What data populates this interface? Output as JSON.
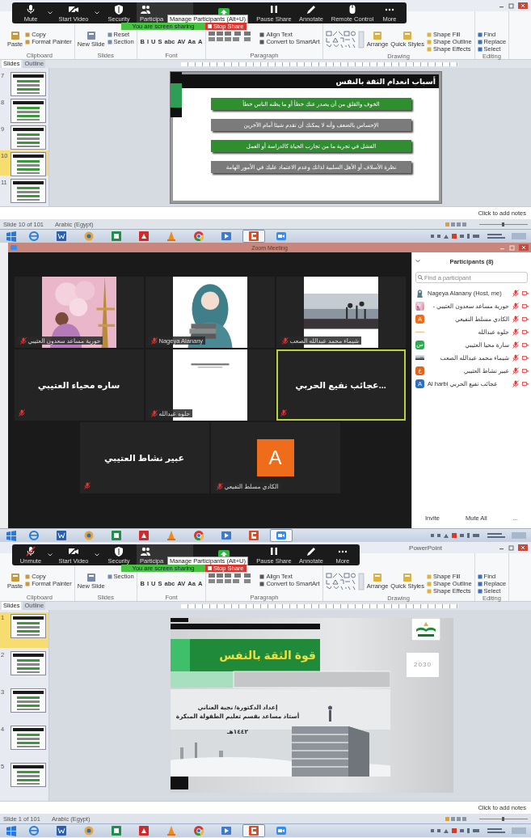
{
  "top_powerpoint": {
    "zoom_toolbar": {
      "buttons": [
        {
          "kind": "mic",
          "label": "Mute",
          "muted": false
        },
        {
          "kind": "video",
          "label": "Start Video"
        },
        {
          "kind": "security",
          "label": "Security"
        },
        {
          "kind": "participants",
          "label": "Participa"
        },
        {
          "kind": "share"
        },
        {
          "kind": "pause",
          "label": "Pause Share"
        },
        {
          "kind": "annotate",
          "label": "Annotate"
        },
        {
          "kind": "remote",
          "label": "Remote Control"
        },
        {
          "kind": "more",
          "label": "More"
        }
      ],
      "tooltip": "Manage Participants (Alt+U)",
      "sharing_text": "You are screen sharing",
      "stop_button": "Stop Share"
    },
    "ribbon": [
      {
        "kind": "clipboard",
        "name": "Clipboard",
        "items": [
          {
            "kind": "large",
            "label": "Paste"
          },
          {
            "kind": "small",
            "label": "Copy"
          },
          {
            "kind": "small",
            "label": "Format Painter"
          }
        ]
      },
      {
        "kind": "slides",
        "name": "Slides",
        "items": [
          {
            "kind": "large",
            "label": "New Slide"
          },
          {
            "kind": "small",
            "label": "Reset"
          },
          {
            "kind": "small",
            "label": "Section"
          }
        ]
      },
      {
        "kind": "font",
        "name": "Font",
        "items": [
          {
            "kind": "glyph",
            "label": "B"
          },
          {
            "kind": "glyph",
            "label": "I"
          },
          {
            "kind": "glyph",
            "label": "U"
          },
          {
            "kind": "glyph",
            "label": "S"
          },
          {
            "kind": "glyph",
            "label": "abc"
          },
          {
            "kind": "glyph",
            "label": "AV"
          },
          {
            "kind": "glyph",
            "label": "Aa"
          },
          {
            "kind": "glyph",
            "label": "A"
          }
        ]
      },
      {
        "kind": "paragraph",
        "name": "Paragraph",
        "items": [
          {
            "kind": "small",
            "label": "Align Text"
          },
          {
            "kind": "small",
            "label": "Convert to SmartArt"
          }
        ]
      },
      {
        "kind": "drawing",
        "name": "Drawing",
        "items": [
          {
            "kind": "large",
            "label": "Arrange"
          },
          {
            "kind": "large",
            "label": "Quick Styles"
          },
          {
            "kind": "small",
            "label": "Shape Fill"
          },
          {
            "kind": "small",
            "label": "Shape Outline"
          },
          {
            "kind": "small",
            "label": "Shape Effects"
          }
        ]
      },
      {
        "kind": "editing",
        "name": "Editing",
        "items": [
          {
            "kind": "small",
            "label": "Find"
          },
          {
            "kind": "small",
            "label": "Replace"
          },
          {
            "kind": "small",
            "label": "Select"
          }
        ]
      }
    ],
    "panel_tabs": [
      {
        "label": "Slides",
        "selected": true
      },
      {
        "label": "Outline",
        "selected": false
      }
    ],
    "thumbnails": [
      {
        "number": "7",
        "selected": false
      },
      {
        "number": "8",
        "selected": false
      },
      {
        "number": "9",
        "selected": false
      },
      {
        "number": "10",
        "selected": true
      },
      {
        "number": "11",
        "selected": false
      }
    ],
    "slide": {
      "kind": "bullets",
      "title": "أسباب انعدام الثقة بالنفس",
      "items": [
        {
          "text": "الخوف والقلق من أن يصدر عنك خطأ أو ما يظنه الناس خطأ",
          "color": "#2f8f2f"
        },
        {
          "text": "الإحساس بالضعف وأنه لا يمكنك أن تقدم شيئا أمام الآخرين",
          "color": "#7b7b7b"
        },
        {
          "text": "الفشل في تجربة ما من تجارب الحياة كالدراسة أو العمل",
          "color": "#2f8f2f"
        },
        {
          "text": "نظرة الأسلاف أو الأهل السلبية لذاتك وعدم الاعتماد عليك في الأمور الهامة",
          "color": "#7b7b7b"
        }
      ]
    },
    "notes_placeholder": "Click to add notes",
    "status_bar": [
      "Slide 10 of 101",
      "Arabic (Egypt)"
    ]
  },
  "taskbar_1": {
    "apps": [
      {
        "selected": false
      },
      {
        "selected": false
      },
      {
        "selected": false
      },
      {
        "selected": false
      },
      {
        "selected": false
      },
      {
        "selected": false
      },
      {
        "selected": false
      },
      {
        "selected": false
      },
      {
        "selected": true
      },
      {
        "selected": false
      }
    ]
  },
  "zoom_meeting": {
    "title": "Zoom Meeting",
    "tiles": [
      {
        "kind": "picture",
        "label": "شيماء محمد عبدالله الصعب",
        "active": false
      },
      {
        "kind": "picture",
        "label": "Nageya Alanany",
        "active": false
      },
      {
        "kind": "picture",
        "label": "حورية مساعد سعدون العتيبي",
        "active": false
      },
      {
        "kind": "name",
        "name": "...عجائب نفيع الحربي",
        "active": true
      },
      {
        "kind": "picture",
        "label": "حلوه عبدالله",
        "active": false
      },
      {
        "kind": "name",
        "name": "ساره محياء العتيبي",
        "active": false
      },
      {
        "kind": "avatar",
        "letter": "A",
        "color": "#ef6c1a",
        "label": "الكادي مسلط النفيعي",
        "active": false
      },
      {
        "kind": "name",
        "name": "عبير نشاط العتيبي",
        "active": false
      }
    ],
    "participants": {
      "title": "Participants (8)",
      "search_placeholder": "Find a participant",
      "people": [
        {
          "name": "Nageya Alanany (Host, me)",
          "kind": "picture"
        },
        {
          "name": "حورية مساعد سعدون العتيبي -",
          "kind": "picture"
        },
        {
          "name": "الكادي مسلط النفيعي",
          "kind": "letter",
          "letter": "A",
          "color": "#ef6c1a"
        },
        {
          "name": "حلوه عبدالله",
          "kind": "none"
        },
        {
          "name": "سارة محيا العتيبي",
          "kind": "letter",
          "letter": "س",
          "color": "#2eaa4f"
        },
        {
          "name": "شيماء محمد عبدالله الصعب",
          "kind": "picture"
        },
        {
          "name": "عبير نشاط العتيبي",
          "kind": "letter",
          "letter": "ع",
          "color": "#e0641a"
        },
        {
          "name": "Al harbi عجائب نفيع الحربي",
          "kind": "letter",
          "letter": "A",
          "color": "#2f6fbf"
        }
      ],
      "buttons": [
        "Invite",
        "Mute All",
        "..."
      ]
    }
  },
  "taskbar_2": {
    "apps": [
      {
        "selected": false
      },
      {
        "selected": false
      },
      {
        "selected": false
      },
      {
        "selected": false
      },
      {
        "selected": false
      },
      {
        "selected": false
      },
      {
        "selected": false
      },
      {
        "selected": false
      },
      {
        "selected": false
      },
      {
        "selected": true
      }
    ]
  },
  "bottom_powerpoint": {
    "title": "PowerPoint",
    "zoom_toolbar": {
      "buttons": [
        {
          "kind": "mic",
          "label": "Unmute",
          "muted": true
        },
        {
          "kind": "video",
          "label": "Start Video"
        },
        {
          "kind": "security",
          "label": "Security"
        },
        {
          "kind": "participants",
          "label": "Participa"
        },
        {
          "kind": "share"
        },
        {
          "kind": "pause",
          "label": "Pause Share"
        },
        {
          "kind": "annotate",
          "label": "Annotate"
        },
        {
          "kind": "more",
          "label": "More"
        }
      ],
      "tooltip": "Manage Participants (Alt+U)",
      "sharing_text": "You are screen sharing",
      "stop_button": "Stop Share"
    },
    "ribbon": [
      {
        "kind": "clipboard",
        "name": "Clipboard",
        "items": [
          {
            "kind": "large",
            "label": "Paste"
          },
          {
            "kind": "small",
            "label": "Copy"
          },
          {
            "kind": "small",
            "label": "Format Painter"
          }
        ]
      },
      {
        "kind": "slides",
        "name": "Slides",
        "items": [
          {
            "kind": "large",
            "label": "New Slide"
          },
          {
            "kind": "small",
            "label": "Section"
          }
        ]
      },
      {
        "kind": "font",
        "name": "Font",
        "items": [
          {
            "kind": "glyph",
            "label": "B"
          },
          {
            "kind": "glyph",
            "label": "I"
          },
          {
            "kind": "glyph",
            "label": "U"
          },
          {
            "kind": "glyph",
            "label": "S"
          },
          {
            "kind": "glyph",
            "label": "abc"
          },
          {
            "kind": "glyph",
            "label": "AV"
          },
          {
            "kind": "glyph",
            "label": "Aa"
          },
          {
            "kind": "glyph",
            "label": "A"
          }
        ]
      },
      {
        "kind": "paragraph",
        "name": "Paragraph",
        "items": [
          {
            "kind": "small",
            "label": "Align Text"
          },
          {
            "kind": "small",
            "label": "Convert to SmartArt"
          }
        ]
      },
      {
        "kind": "drawing",
        "name": "Drawing",
        "items": [
          {
            "kind": "large",
            "label": "Arrange"
          },
          {
            "kind": "large",
            "label": "Quick Styles"
          },
          {
            "kind": "small",
            "label": "Shape Fill"
          },
          {
            "kind": "small",
            "label": "Shape Outline"
          },
          {
            "kind": "small",
            "label": "Shape Effects"
          }
        ]
      },
      {
        "kind": "editing",
        "name": "Editing",
        "items": [
          {
            "kind": "small",
            "label": "Find"
          },
          {
            "kind": "small",
            "label": "Replace"
          },
          {
            "kind": "small",
            "label": "Select"
          }
        ]
      }
    ],
    "panel_tabs": [
      {
        "label": "Slides",
        "selected": true
      },
      {
        "label": "Outline",
        "selected": false
      }
    ],
    "thumbnails": [
      {
        "number": "1",
        "selected": true
      },
      {
        "number": "2",
        "selected": false
      },
      {
        "number": "3",
        "selected": false
      },
      {
        "number": "4",
        "selected": false
      },
      {
        "number": "5",
        "selected": false
      }
    ],
    "slide": {
      "kind": "title",
      "title": "قوة الثقة بالنفس",
      "lines": [
        "إعداد الدكتورة/ نجية العناني",
        "أستاذ مساعد بقسم تعليم الطفولة المبكرة",
        "١٤٤٢هـ"
      ],
      "badge": "2030"
    },
    "notes_placeholder": "Click to add notes",
    "status_bar": [
      "Slide 1 of 101",
      "Arabic (Egypt)"
    ]
  },
  "taskbar_3": {
    "apps": [
      {
        "selected": false
      },
      {
        "selected": false
      },
      {
        "selected": false
      },
      {
        "selected": false
      },
      {
        "selected": false
      },
      {
        "selected": false
      },
      {
        "selected": false
      },
      {
        "selected": false
      },
      {
        "selected": true
      },
      {
        "selected": false
      }
    ]
  }
}
